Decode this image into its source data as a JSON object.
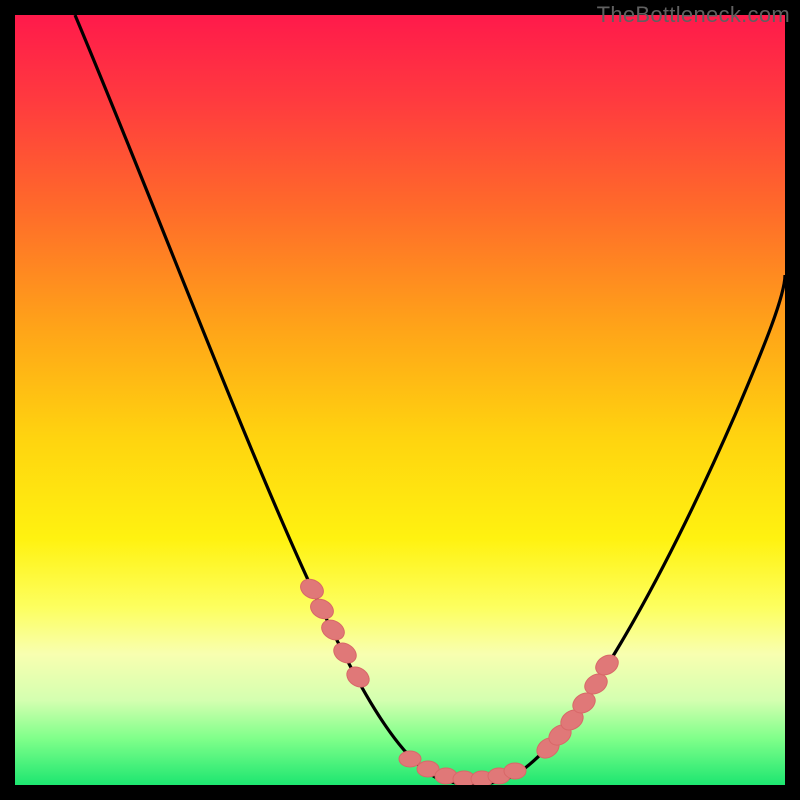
{
  "watermark": "TheBottleneck.com",
  "chart_data": {
    "type": "line",
    "title": "",
    "xlabel": "",
    "ylabel": "",
    "xlim": [
      0,
      100
    ],
    "ylim": [
      0,
      100
    ],
    "grid": false,
    "legend": false,
    "series": [
      {
        "name": "bottleneck-curve",
        "color": "#000000",
        "x": [
          0,
          5,
          10,
          15,
          20,
          25,
          30,
          35,
          40,
          44,
          48,
          52,
          56,
          60,
          64,
          68,
          72,
          76,
          80,
          84,
          88,
          92,
          96,
          100
        ],
        "y": [
          100,
          91,
          82,
          73,
          64,
          55,
          46,
          37,
          28,
          20,
          13,
          6,
          1,
          0,
          0,
          1,
          5,
          11,
          19,
          28,
          38,
          49,
          61,
          74
        ]
      }
    ],
    "markers": [
      {
        "name": "highlight-points",
        "color": "#e07878",
        "x": [
          37,
          38.5,
          40,
          41.5,
          43,
          49,
          51,
          53,
          55,
          57,
          59,
          60.5,
          64,
          65.5,
          67,
          68.5,
          70,
          71.5
        ],
        "y": [
          33,
          30,
          27,
          24,
          21,
          5,
          3,
          1.5,
          1,
          1,
          1,
          1.5,
          4.5,
          6,
          8,
          10.5,
          13,
          16
        ]
      }
    ],
    "background_gradient": {
      "top": "#ff1a4b",
      "bottom": "#1de670"
    }
  }
}
